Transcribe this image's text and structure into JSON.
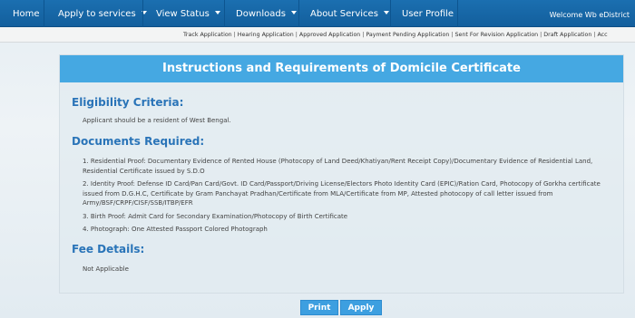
{
  "nav": {
    "home": "Home",
    "apply": "Apply to services",
    "view_status": "View Status",
    "downloads": "Downloads",
    "about": "About Services",
    "profile": "User Profile",
    "welcome": "Welcome Wb eDistrict"
  },
  "sub_nav": {
    "links": [
      "Track Application",
      "Hearing Application",
      "Approved Application",
      "Payment Pending Application",
      "Sent For Revision Application",
      "Draft Application",
      "Acc"
    ],
    "separator": "|"
  },
  "panel": {
    "title": "Instructions and Requirements of Domicile Certificate",
    "eligibility": {
      "heading": "Eligibility Criteria:",
      "text": "Applicant should be a resident of West Bengal."
    },
    "documents": {
      "heading": "Documents Required:",
      "items": [
        "1. Residential Proof: Documentary Evidence of Rented House (Photocopy of Land Deed/Khatiyan/Rent Receipt Copy)/Documentary Evidence of Residential Land, Residential Certificate issued by S.D.O",
        "2. Identity Proof: Defense ID Card/Pan Card/Govt. ID Card/Passport/Driving License/Electors Photo Identity Card (EPIC)/Ration Card, Photocopy of Gorkha certificate issued from D.G.H.C, Certificate by Gram Panchayat Pradhan/Certificate from MLA/Certificate from MP, Attested photocopy of call letter issued from Army/BSF/CRPF/CISF/SSB/ITBP/EFR",
        "3. Birth Proof: Admit Card for Secondary Examination/Photocopy of Birth Certificate",
        "4. Photograph: One Attested Passport Colored Photograph"
      ]
    },
    "fee": {
      "heading": "Fee Details:",
      "text": "Not Applicable"
    }
  },
  "buttons": {
    "print": "Print",
    "apply": "Apply"
  }
}
